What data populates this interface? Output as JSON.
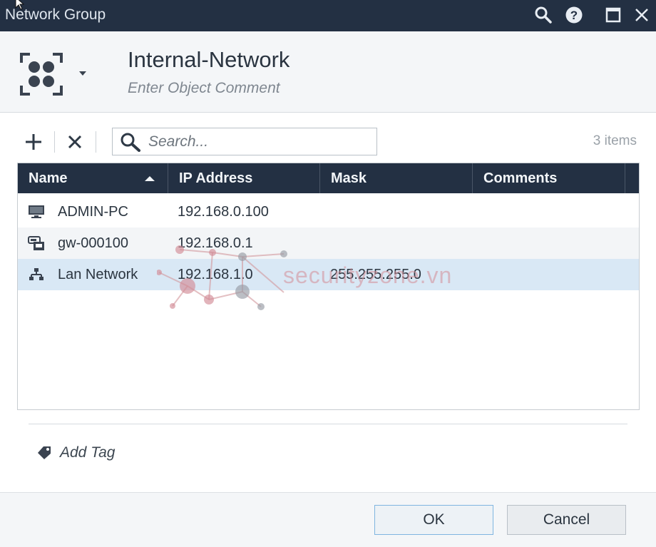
{
  "window": {
    "title": "Network Group"
  },
  "header": {
    "name": "Internal-Network",
    "comment_placeholder": "Enter Object Comment"
  },
  "toolbar": {
    "search_placeholder": "Search...",
    "item_count": "3 items"
  },
  "table": {
    "columns": [
      "Name",
      "IP Address",
      "Mask",
      "Comments"
    ],
    "rows": [
      {
        "icon": "computer-icon",
        "name": "ADMIN-PC",
        "ip": "192.168.0.100",
        "mask": "",
        "comments": ""
      },
      {
        "icon": "gateway-icon",
        "name": "gw-000100",
        "ip": "192.168.0.1",
        "mask": "",
        "comments": ""
      },
      {
        "icon": "network-icon",
        "name": "Lan Network",
        "ip": "192.168.1.0",
        "mask": "255.255.255.0",
        "comments": ""
      }
    ]
  },
  "tags": {
    "add_label": "Add Tag"
  },
  "footer": {
    "ok_label": "OK",
    "cancel_label": "Cancel"
  },
  "watermark": {
    "text": "securityzone.vn"
  },
  "colors": {
    "titlebar": "#233043",
    "header_bg": "#f4f6f8",
    "selected_row": "#d9e8f5",
    "alt_row": "#f3f5f7"
  }
}
